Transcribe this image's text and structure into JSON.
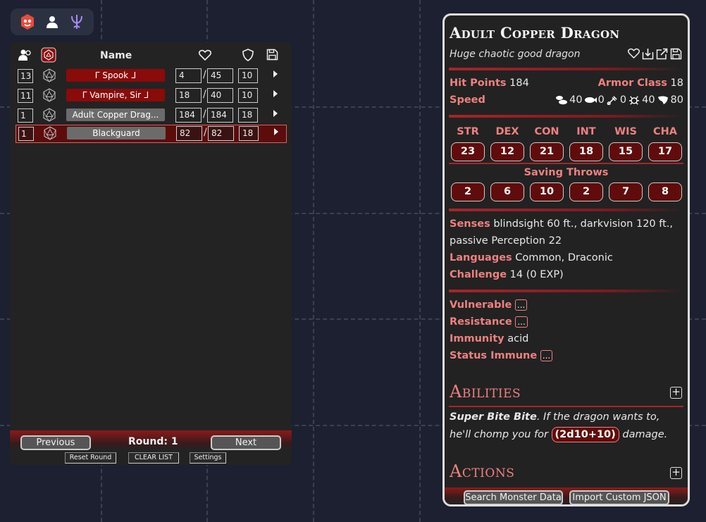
{
  "toolbar": {
    "items": [
      {
        "name": "monster-tracker-icon",
        "color": "#e74c3c"
      },
      {
        "name": "player-icon",
        "color": "#ffffff"
      },
      {
        "name": "trident-icon",
        "color": "#a78bfa"
      }
    ]
  },
  "tracker": {
    "header": {
      "name_label": "Name"
    },
    "rows": [
      {
        "init": "13",
        "name": "ᒥ Spook ᒧ",
        "hp": "4",
        "max_hp": "45",
        "ac": "10",
        "style": "red",
        "active": false
      },
      {
        "init": "11",
        "name": "ᒥ Vampire, Sir ᒧ",
        "hp": "18",
        "max_hp": "40",
        "ac": "10",
        "style": "red",
        "active": false
      },
      {
        "init": "1",
        "name": "Adult Copper Drag...",
        "hp": "184",
        "max_hp": "184",
        "ac": "18",
        "style": "grey",
        "active": false
      },
      {
        "init": "1",
        "name": "Blackguard",
        "hp": "82",
        "max_hp": "82",
        "ac": "18",
        "style": "grey",
        "active": true
      }
    ],
    "footer": {
      "previous_label": "Previous",
      "round_label": "Round: 1",
      "next_label": "Next",
      "reset_label": "Reset Round",
      "clear_label": "CLEAR LIST",
      "settings_label": "Settings"
    }
  },
  "statblock": {
    "name": "Adult Copper Dragon",
    "type": "Huge chaotic good dragon",
    "hit_points_label": "Hit Points",
    "hit_points": "184",
    "armor_class_label": "Armor Class",
    "armor_class": "18",
    "speed_label": "Speed",
    "speeds": [
      {
        "icon": "walk-icon",
        "value": "40"
      },
      {
        "icon": "swim-icon",
        "value": "0"
      },
      {
        "icon": "climb-icon",
        "value": "0"
      },
      {
        "icon": "burrow-icon",
        "value": "40"
      },
      {
        "icon": "fly-icon",
        "value": "80"
      }
    ],
    "abilities": [
      {
        "label": "STR",
        "score": "23"
      },
      {
        "label": "DEX",
        "score": "12"
      },
      {
        "label": "CON",
        "score": "21"
      },
      {
        "label": "INT",
        "score": "18"
      },
      {
        "label": "WIS",
        "score": "15"
      },
      {
        "label": "CHA",
        "score": "17"
      }
    ],
    "saving_throws_label": "Saving Throws",
    "saving_throws": [
      "2",
      "6",
      "10",
      "2",
      "7",
      "8"
    ],
    "senses_label": "Senses",
    "senses_line1": "blindsight 60 ft., darkvision 120 ft.,",
    "senses_line2": "passive Perception 22",
    "languages_label": "Languages",
    "languages": "Common, Draconic",
    "challenge_label": "Challenge",
    "challenge": "14 (0 EXP)",
    "vulnerable_label": "Vulnerable",
    "resistance_label": "Resistance",
    "immunity_label": "Immunity",
    "immunity": "acid",
    "status_immune_label": "Status Immune",
    "ellipsis": "...",
    "abilities_title": "Abilities",
    "ability_name": "Super Bite Bite",
    "ability_text_1": ". If the dragon wants to, he'll chomp you for",
    "ability_roll": "(2d10+10)",
    "ability_text_2": "damage.",
    "actions_title": "Actions",
    "search_label": "Search Monster Data",
    "import_label": "Import Custom JSON"
  },
  "colors": {
    "background": "#1c2030",
    "accent_red": "#8b0a0a",
    "label_pink": "#f08080"
  }
}
